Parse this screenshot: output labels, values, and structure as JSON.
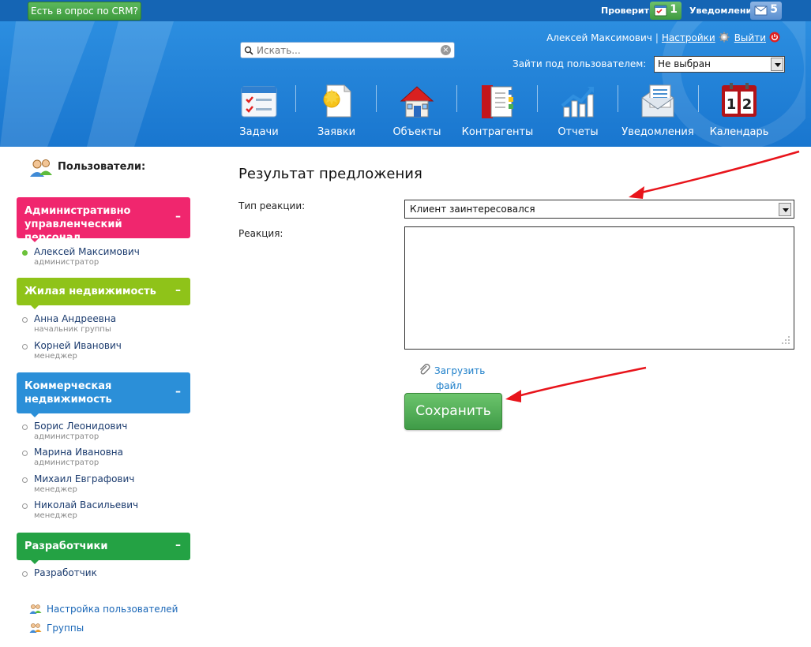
{
  "topbar": {
    "survey_button": "Есть в опрос по CRM?",
    "check_label": "Проверить",
    "check_count": "1",
    "notifications_label": "Уведомления",
    "notifications_count": "5"
  },
  "header": {
    "search_placeholder": "Искать...",
    "user_name": "Алексей Максимович",
    "settings_link": "Настройки",
    "logout_link": "Выйти",
    "login_as_label": "Зайти под пользователем:",
    "login_as_value": "Не выбран",
    "nav": [
      {
        "label": "Задачи",
        "icon": "tasks-icon"
      },
      {
        "label": "Заявки",
        "icon": "requests-icon"
      },
      {
        "label": "Объекты",
        "icon": "objects-icon"
      },
      {
        "label": "Контрагенты",
        "icon": "contractors-icon"
      },
      {
        "label": "Отчеты",
        "icon": "reports-icon"
      },
      {
        "label": "Уведомления",
        "icon": "notifications-icon"
      },
      {
        "label": "Календарь",
        "icon": "calendar-icon"
      }
    ]
  },
  "sidebar": {
    "title": "Пользователи:",
    "groups": [
      {
        "name": "Административно управленческий персонал",
        "toggle": "–",
        "people": [
          {
            "name": "Алексей Максимович",
            "role": "администратор"
          }
        ]
      },
      {
        "name": "Жилая недвижимость",
        "toggle": "–",
        "people": [
          {
            "name": "Анна Андреевна",
            "role": "начальник группы"
          },
          {
            "name": "Корней Иванович",
            "role": "менеджер"
          }
        ]
      },
      {
        "name": "Коммерческая недвижимость",
        "toggle": "–",
        "people": [
          {
            "name": "Борис Леонидович",
            "role": "администратор"
          },
          {
            "name": "Марина Ивановна",
            "role": "администратор"
          },
          {
            "name": "Михаил Евграфович",
            "role": "менеджер"
          },
          {
            "name": "Николай Васильевич",
            "role": "менеджер"
          }
        ]
      },
      {
        "name": "Разработчики",
        "toggle": "–",
        "people": [
          {
            "name": "Разработчик",
            "role": ""
          }
        ]
      }
    ],
    "links": {
      "user_settings": "Настройка пользователей",
      "groups": "Группы"
    }
  },
  "main": {
    "title": "Результат предложения",
    "reaction_type_label": "Тип реакции:",
    "reaction_type_value": "Клиент заинтересовался",
    "reaction_label": "Реакция:",
    "reaction_value": "",
    "upload_line1": "Загрузить",
    "upload_line2": "файл",
    "save_button": "Сохранить"
  },
  "colors": {
    "header_blue": "#1976cf",
    "group_admin": "#f0266e",
    "group_residential": "#8fc319",
    "group_commercial": "#2b8fd8",
    "group_developers": "#24a244",
    "annotation_arrow": "#e8141b"
  }
}
